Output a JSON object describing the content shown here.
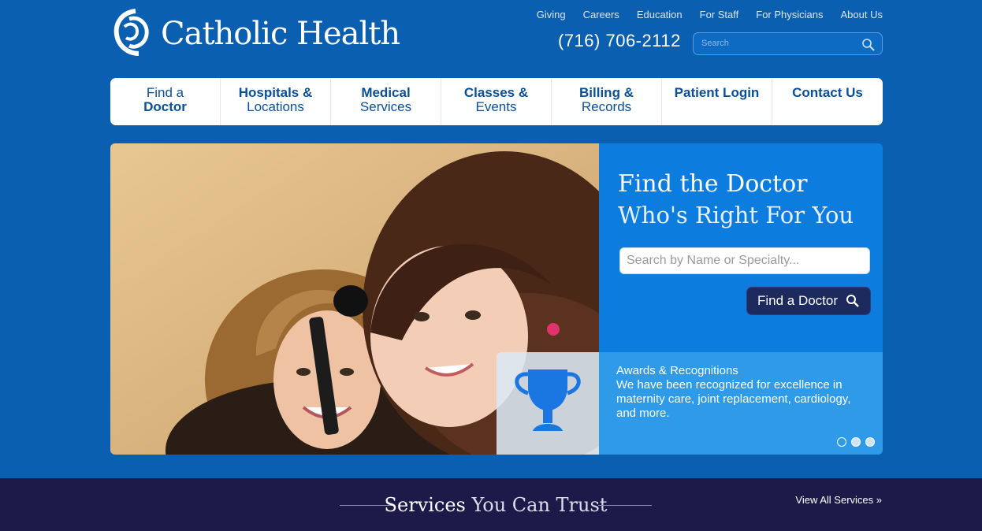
{
  "header": {
    "logo_text": "Catholic Health",
    "utility_nav": [
      "Giving",
      "Careers",
      "Education",
      "For Staff",
      "For Physicians",
      "About Us"
    ],
    "phone": "(716) 706-2112",
    "search_placeholder": "Search"
  },
  "main_nav": [
    {
      "line1": "Find a",
      "line2": "Doctor"
    },
    {
      "line1": "Hospitals &",
      "line2": "Locations"
    },
    {
      "line1": "Medical",
      "line2": "Services"
    },
    {
      "line1": "Classes &",
      "line2": "Events"
    },
    {
      "line1": "Billing &",
      "line2": "Records"
    },
    {
      "line1": "Patient Login",
      "line2": ""
    },
    {
      "line1": "Contact Us",
      "line2": ""
    }
  ],
  "hero": {
    "title_line1": "Find the Doctor",
    "title_line2": "Who's Right For You",
    "search_placeholder": "Search by Name or Specialty...",
    "button_label": "Find a Doctor",
    "awards_title": "Awards & Recognitions",
    "awards_text": "We have been recognized for excellence in maternity care, joint replacement, cardiology, and more.",
    "slides_total": 3,
    "active_slide": 1
  },
  "services": {
    "title_bold": "Services",
    "title_light": " You Can Trust",
    "view_all": "View All Services »"
  },
  "colors": {
    "background": "#0b5fb0",
    "nav_text": "#0b4f96",
    "hero_panel": "#0c7ddf",
    "button": "#1c2a5e",
    "services_band": "#1d1a4a"
  }
}
